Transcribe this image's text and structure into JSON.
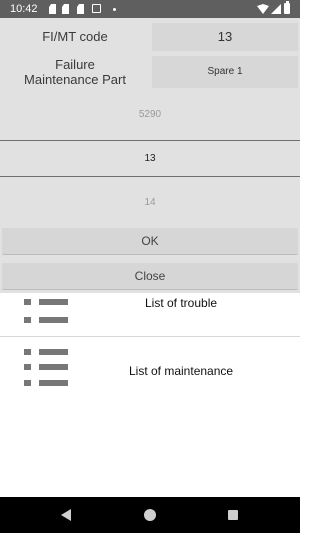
{
  "status_bar": {
    "time": "10:42",
    "icons": [
      "sd-card-icon",
      "sd-card-icon",
      "sd-card-icon",
      "print-icon",
      "dot-icon",
      "wifi-icon",
      "signal-icon",
      "battery-icon"
    ]
  },
  "dialog": {
    "fimt_label": "FI/MT code",
    "fimt_value": "13",
    "part_label_line1": "Failure",
    "part_label_line2": "Maintenance Part",
    "part_value": "Spare 1",
    "picker": {
      "prev": "5290",
      "selected": "13",
      "next": "14"
    },
    "ok_label": "OK",
    "close_label": "Close"
  },
  "list": {
    "items": [
      {
        "label": "List of trouble",
        "icon": "list-icon"
      },
      {
        "label": "List of maintenance",
        "icon": "list-icon"
      }
    ]
  },
  "colors": {
    "status_bar": "#5f5f5f",
    "dialog_bg": "#e1e1e1",
    "button_bg": "#d6d6d6",
    "nav_bar": "#000000"
  }
}
